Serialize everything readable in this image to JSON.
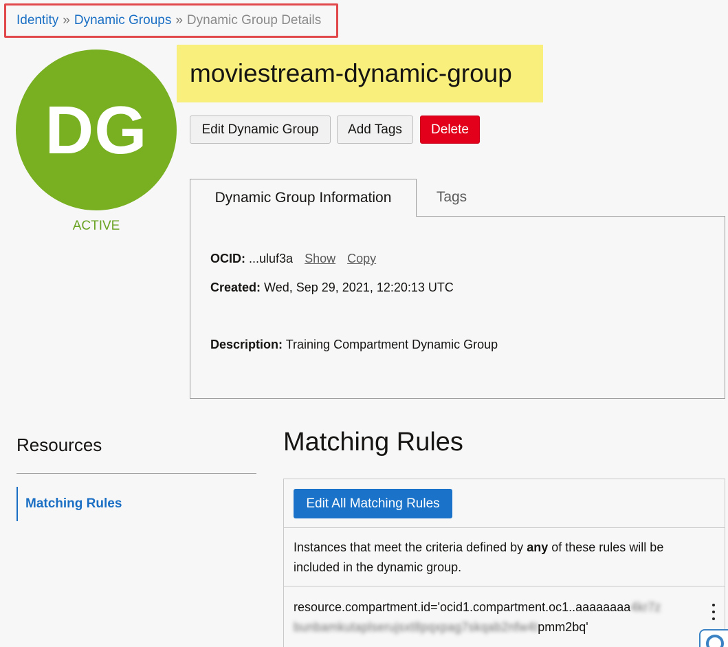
{
  "breadcrumb": {
    "items": [
      "Identity",
      "Dynamic Groups"
    ],
    "separator": "»",
    "current": "Dynamic Group Details"
  },
  "avatar": {
    "initials": "DG",
    "color": "#78b022"
  },
  "status": "ACTIVE",
  "title": "moviestream-dynamic-group",
  "actions": {
    "edit": "Edit Dynamic Group",
    "add_tags": "Add Tags",
    "delete": "Delete"
  },
  "tabs": {
    "info": "Dynamic Group Information",
    "tags": "Tags"
  },
  "info": {
    "ocid_label": "OCID:",
    "ocid_value": "...uluf3a",
    "show": "Show",
    "copy": "Copy",
    "created_label": "Created:",
    "created_value": "Wed, Sep 29, 2021, 12:20:13 UTC",
    "description_label": "Description:",
    "description_value": "Training Compartment Dynamic Group"
  },
  "resources": {
    "heading": "Resources",
    "items": [
      "Matching Rules"
    ]
  },
  "matching_rules": {
    "heading": "Matching Rules",
    "edit_button": "Edit All Matching Rules",
    "description_pre": "Instances that meet the criteria defined by",
    "description_bold": "any",
    "description_post": "of these rules will be included in the dynamic group.",
    "rule_prefix": "resource.compartment.id='ocid1.compartment.oc1..aaaaaaaa",
    "rule_blurred_1": "4kr7z",
    "rule_blurred_2": "bunbamkutaplserujsxt8pqxpag7skqab2nfw4t",
    "rule_suffix": "pmm2bq'"
  }
}
